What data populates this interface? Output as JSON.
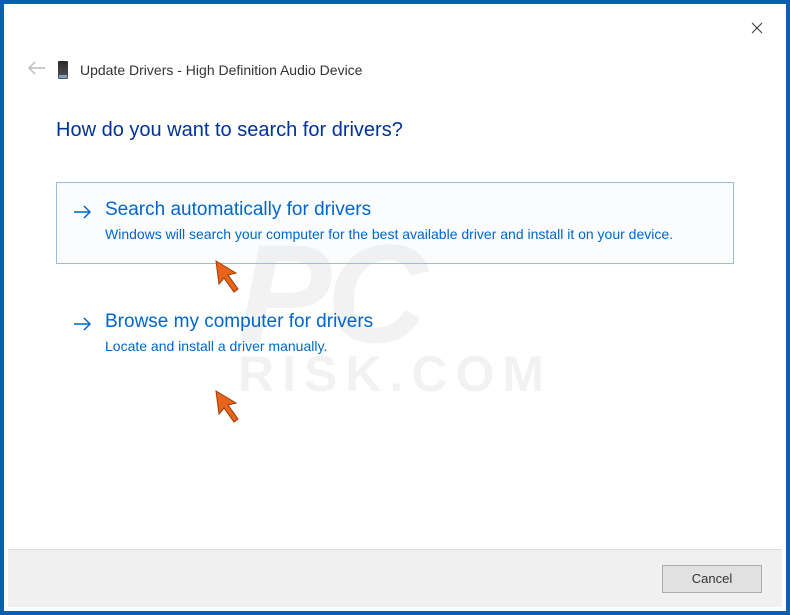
{
  "window": {
    "title": "Update Drivers - High Definition Audio Device"
  },
  "heading": "How do you want to search for drivers?",
  "options": {
    "auto": {
      "title": "Search automatically for drivers",
      "description": "Windows will search your computer for the best available driver and install it on your device."
    },
    "browse": {
      "title": "Browse my computer for drivers",
      "description": "Locate and install a driver manually."
    }
  },
  "footer": {
    "cancel_label": "Cancel"
  },
  "watermark": {
    "main": "PC",
    "sub": "RISK.COM"
  }
}
